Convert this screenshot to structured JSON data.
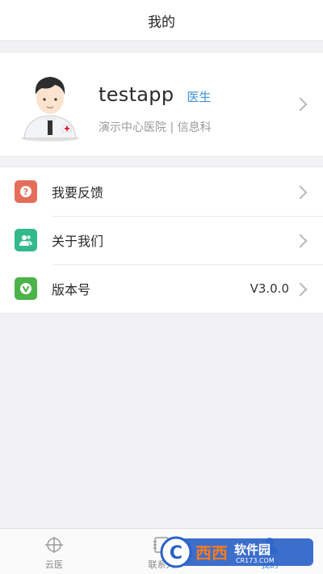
{
  "header": {
    "title": "我的"
  },
  "profile": {
    "name": "testapp",
    "role": "医生",
    "org": "演示中心医院 |  信息科"
  },
  "menu": {
    "items": [
      {
        "label": "我要反馈",
        "icon": "question-icon",
        "color": "#e36f5a"
      },
      {
        "label": "关于我们",
        "icon": "people-icon",
        "color": "#34b98a"
      },
      {
        "label": "版本号",
        "icon": "v-badge-icon",
        "color": "#4cb34a",
        "value": "V3.0.0"
      }
    ]
  },
  "tabbar": {
    "tabs": [
      {
        "label": "云医",
        "active": false
      },
      {
        "label": "联系人",
        "active": false
      },
      {
        "label": "我的",
        "active": true
      }
    ],
    "active_color": "#3d8fd1",
    "inactive_color": "#888888"
  },
  "watermark": {
    "text": "西西软件园",
    "sub": "CR173.COM"
  }
}
